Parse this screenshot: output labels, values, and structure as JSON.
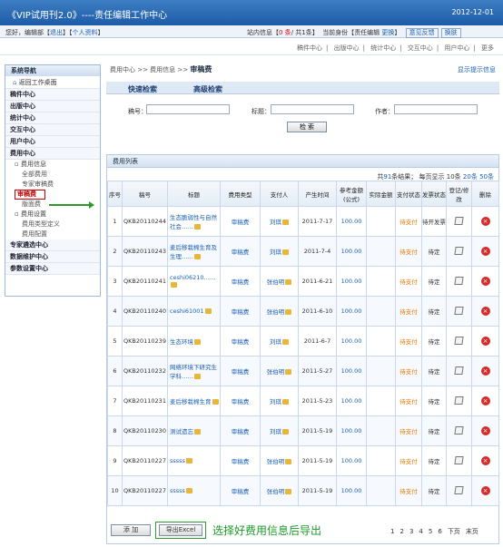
{
  "header": {
    "title": "《VIP试用刊2.0》----责任编辑工作中心",
    "date": "2012-12-01"
  },
  "topbar": {
    "greeting": "您好，编辑部【",
    "logout": "退出",
    "sep": "】【",
    "profile": "个人资料",
    "close": "】",
    "msg_prefix": "站内信息【",
    "msg_new": "0 条",
    "msg_suffix": "/ 共1条】",
    "identity_prefix": "当前身份【",
    "identity": "责任编辑",
    "change": "更换",
    "identity_suffix": "】",
    "feedback": "意见反馈",
    "switch": "换肤"
  },
  "mainnav": {
    "items": [
      "稿件中心",
      "出版中心",
      "统计中心",
      "交互中心",
      "用户中心",
      "更多"
    ]
  },
  "sidebar": {
    "title": "系统导航",
    "desk": "返回工作桌面",
    "groups": [
      "稿件中心",
      "出版中心",
      "统计中心",
      "交互中心",
      "用户中心",
      "费用中心"
    ],
    "fee_info": "费用信息",
    "fee_all": "全部费用",
    "fee_expert": "专家审稿费",
    "fee_review": "审稿费",
    "fee_layout": "版面费",
    "fee_setting": "费用设置",
    "fee_type_def": "费用类型定义",
    "fee_config": "费用配置",
    "groups2": [
      "专家遴选中心",
      "数据维护中心",
      "参数设置中心"
    ]
  },
  "breadcrumb": {
    "path": "费用中心 >> 费用信息 >>",
    "current": "审稿费",
    "tip": "显示提示信息"
  },
  "tabs": {
    "quick": "快速检索",
    "advanced": "高级检索"
  },
  "search": {
    "manuscript_label": "稿号：",
    "title_label": "标题：",
    "author_label": "作者：",
    "button": "检 索"
  },
  "list": {
    "title": "费用列表",
    "count_prefix": "共",
    "count": "91",
    "count_mid": "条结果； 每页显示",
    "sizes": [
      "10条",
      "20条",
      "50条"
    ],
    "headers": [
      "序号",
      "稿号",
      "标题",
      "费用类型",
      "支付人",
      "产生时间",
      "参考金额(公式)",
      "实际金额",
      "支付状态",
      "发票状态",
      "登记/修改",
      "删除"
    ],
    "rows": [
      {
        "no": "1",
        "id": "QKB20110244",
        "title": "生态脆弱性与自然社会……",
        "type": "审稿费",
        "payer": "刘琪",
        "date": "2011-7-17",
        "amount": "100.00",
        "actual": "",
        "pay": "待支付",
        "invoice": "待开发票"
      },
      {
        "no": "2",
        "id": "QKB20110243",
        "title": "麦后移栽棉生育及生理……",
        "type": "审稿费",
        "payer": "刘琪",
        "date": "2011-7-4",
        "amount": "100.00",
        "actual": "",
        "pay": "待支付",
        "invoice": "待定"
      },
      {
        "no": "3",
        "id": "QKB20110241",
        "title": "ceshi06210……",
        "type": "审稿费",
        "payer": "张伯明",
        "date": "2011-6-21",
        "amount": "100.00",
        "actual": "",
        "pay": "待支付",
        "invoice": "待定"
      },
      {
        "no": "4",
        "id": "QKB20110240",
        "title": "ceshi61001",
        "type": "审稿费",
        "payer": "张伯明",
        "date": "2011-6-10",
        "amount": "100.00",
        "actual": "",
        "pay": "待支付",
        "invoice": "待定"
      },
      {
        "no": "5",
        "id": "QKB20110239",
        "title": "生态环境",
        "type": "审稿费",
        "payer": "刘琪",
        "date": "2011-6-7",
        "amount": "100.00",
        "actual": "",
        "pay": "待支付",
        "invoice": "待定"
      },
      {
        "no": "6",
        "id": "QKB20110232",
        "title": "网络环境下研究生学科……",
        "type": "审稿费",
        "payer": "张伯明",
        "date": "2011-5-27",
        "amount": "100.00",
        "actual": "",
        "pay": "待支付",
        "invoice": "待定"
      },
      {
        "no": "7",
        "id": "QKB20110231",
        "title": "麦后移栽棉生育",
        "type": "审稿费",
        "payer": "刘琪",
        "date": "2011-5-23",
        "amount": "100.00",
        "actual": "",
        "pay": "待支付",
        "invoice": "待定"
      },
      {
        "no": "8",
        "id": "QKB20110230",
        "title": "测试遗忘",
        "type": "审稿费",
        "payer": "刘琪",
        "date": "2011-5-19",
        "amount": "100.00",
        "actual": "",
        "pay": "待支付",
        "invoice": "待定"
      },
      {
        "no": "9",
        "id": "QKB20110227",
        "title": "sssss",
        "type": "审稿费",
        "payer": "张伯明",
        "date": "2011-5-19",
        "amount": "100.00",
        "actual": "",
        "pay": "待支付",
        "invoice": "待定"
      },
      {
        "no": "10",
        "id": "QKB20110227",
        "title": "sssss",
        "type": "审稿费",
        "payer": "张伯明",
        "date": "2011-5-19",
        "amount": "100.00",
        "actual": "",
        "pay": "待支付",
        "invoice": "待定"
      }
    ]
  },
  "footer": {
    "add": "添 加",
    "export": "导出Excel",
    "annotation": "选择好费用信息后导出",
    "pages": [
      "1",
      "2",
      "3",
      "4",
      "5",
      "6"
    ],
    "next": "下页",
    "last": "末页"
  },
  "colors": {
    "header": "#1d5ba8",
    "annotation": "#1b9b2a",
    "link": "#1a5fb4",
    "status": "#e87800",
    "delete": "#d42a2a"
  }
}
